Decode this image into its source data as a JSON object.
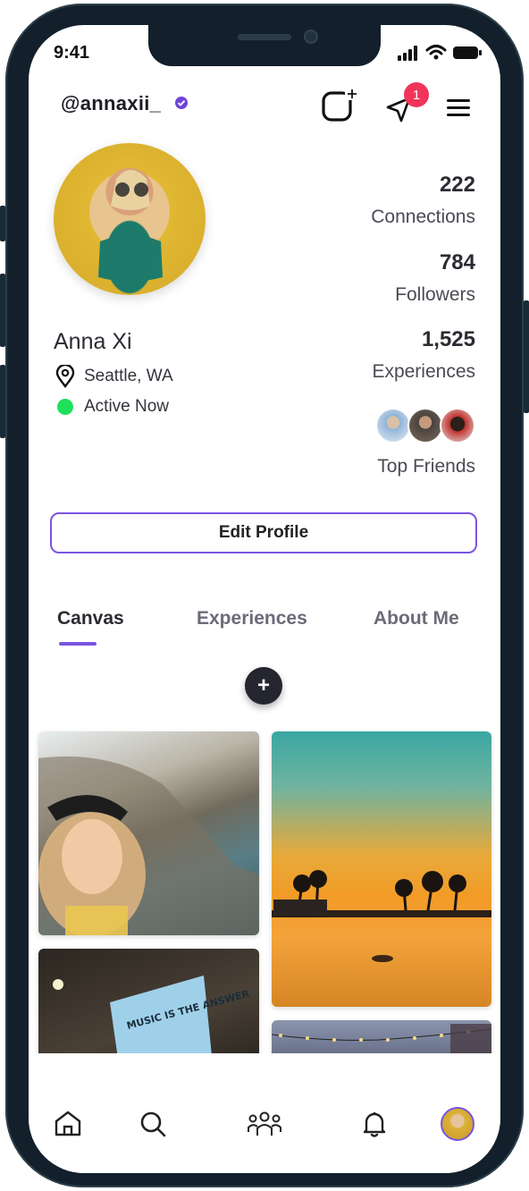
{
  "status_bar": {
    "time": "9:41"
  },
  "header": {
    "handle": "@annaxii_",
    "notification_count": "1"
  },
  "profile": {
    "name": "Anna Xi",
    "location": "Seattle, WA",
    "status": "Active Now"
  },
  "stats": [
    {
      "value": "222",
      "label": "Connections"
    },
    {
      "value": "784",
      "label": "Followers"
    },
    {
      "value": "1,525",
      "label": "Experiences"
    }
  ],
  "top_friends_label": "Top Friends",
  "edit_profile_label": "Edit Profile",
  "tabs": [
    {
      "label": "Canvas",
      "active": true
    },
    {
      "label": "Experiences",
      "active": false
    },
    {
      "label": "About Me",
      "active": false
    }
  ],
  "fab_label": "+",
  "photos": [
    {
      "alt": "girl-on-cliff"
    },
    {
      "alt": "sunset-beach"
    },
    {
      "alt": "music-sign",
      "caption": "MUSIC IS THE ANSWER"
    },
    {
      "alt": "string-lights"
    }
  ],
  "nav": {
    "items": [
      "home-icon",
      "search-icon",
      "community-icon",
      "bell-icon",
      "profile-avatar"
    ]
  },
  "colors": {
    "accent": "#7a55e0",
    "online": "#1fe05a",
    "badge": "#f0345a"
  }
}
